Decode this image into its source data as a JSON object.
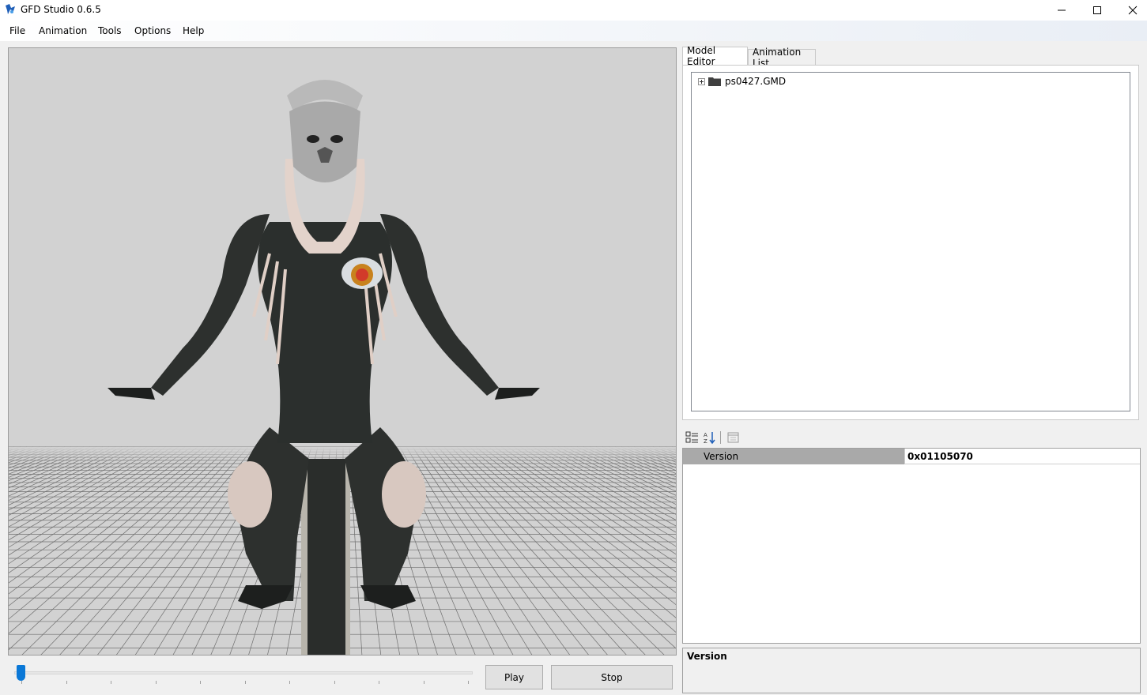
{
  "window": {
    "title": "GFD Studio 0.6.5"
  },
  "menu": [
    {
      "label": "File"
    },
    {
      "label": "Animation"
    },
    {
      "label": "Tools"
    },
    {
      "label": "Options"
    },
    {
      "label": "Help"
    }
  ],
  "playback": {
    "play_label": "Play",
    "stop_label": "Stop",
    "position": 0.0
  },
  "tabs": [
    {
      "label": "Model Editor",
      "active": true
    },
    {
      "label": "Animation List",
      "active": false
    }
  ],
  "tree": {
    "root_label": "ps0427.GMD"
  },
  "property_grid": {
    "rows": [
      {
        "name": "Version",
        "value": "0x01105070"
      }
    ],
    "description_title": "Version"
  },
  "colors": {
    "accent": "#0a78d7",
    "viewport_bg": "#d2d2d2",
    "selected_row": "#a9a9a9"
  }
}
